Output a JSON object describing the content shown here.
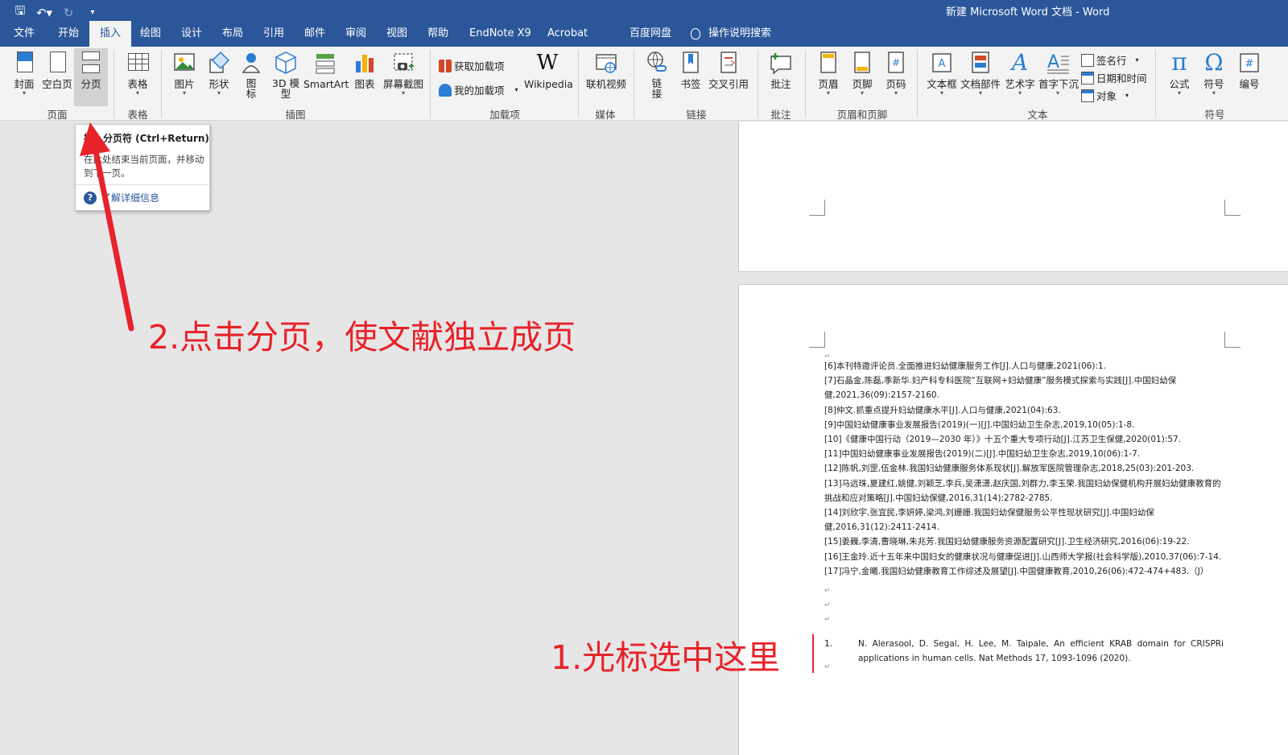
{
  "titlebar": {
    "title": "新建 Microsoft Word 文档  -  Word",
    "qat": [
      "save-icon",
      "undo-icon",
      "redo-icon",
      "customize-icon"
    ]
  },
  "tabs": [
    {
      "label": "文件"
    },
    {
      "label": "开始"
    },
    {
      "label": "插入",
      "active": true
    },
    {
      "label": "绘图"
    },
    {
      "label": "设计"
    },
    {
      "label": "布局"
    },
    {
      "label": "引用"
    },
    {
      "label": "邮件"
    },
    {
      "label": "审阅"
    },
    {
      "label": "视图"
    },
    {
      "label": "帮助"
    },
    {
      "label": "EndNote X9"
    },
    {
      "label": "Acrobat"
    },
    {
      "label": "百度网盘"
    },
    {
      "label": "操作说明搜索"
    }
  ],
  "ribbon": {
    "pages": {
      "cover": "封面",
      "blank": "空白页",
      "break": "分页",
      "group": "页面"
    },
    "tables": {
      "table": "表格",
      "group": "表格"
    },
    "illustrations": {
      "picture": "图片",
      "shapes": "形状",
      "icons": "图\n标",
      "model3d": "3D 模\n型",
      "smartart": "SmartArt",
      "chart": "图表",
      "screenshot": "屏幕截图",
      "group": "插图"
    },
    "addins": {
      "get": "获取加载项",
      "my": "我的加载项",
      "wikipedia": "Wikipedia",
      "group": "加载项"
    },
    "media": {
      "video": "联机视频",
      "group": "媒体"
    },
    "links": {
      "link": "链\n接",
      "bookmark": "书签",
      "crossref": "交叉引用",
      "group": "链接"
    },
    "comments": {
      "comment": "批注",
      "group": "批注"
    },
    "headerfooter": {
      "header": "页眉",
      "footer": "页脚",
      "pagenum": "页码",
      "group": "页眉和页脚"
    },
    "text": {
      "textbox": "文本框",
      "parts": "文档部件",
      "wordart": "艺术字",
      "dropcap": "首字下沉",
      "signature": "签名行",
      "datetime": "日期和时间",
      "object": "对象",
      "group": "文本"
    },
    "symbols": {
      "equation": "公式",
      "symbol": "符号",
      "number": "编号",
      "group": "符号"
    }
  },
  "tooltip": {
    "title": "插入分页符 (Ctrl+Return)",
    "desc": "在此处结束当前页面，并移动到下一页。",
    "help": "了解详细信息"
  },
  "document": {
    "refs": [
      "[6]本刊特邀评论员.全面推进妇幼健康服务工作[J].人口与健康,2021(06):1.",
      "[7]石晶金,陈磊,季新华.妇产科专科医院“互联网+妇幼健康”服务模式探索与实践[J].中国妇幼保",
      "健,2021,36(09):2157-2160.",
      "[8]仲文.抓重点提升妇幼健康水平[J].人口与健康,2021(04):63.",
      "[9]中国妇幼健康事业发展报告(2019)(一)[J].中国妇幼卫生杂志,2019,10(05):1-8.",
      "[10]《健康中国行动（2019—2030 年）》十五个重大专项行动[J].江苏卫生保健,2020(01):57.",
      "[11]中国妇幼健康事业发展报告(2019)(二)[J].中国妇幼卫生杂志,2019,10(06):1-7.",
      "[12]陈帆,刘罡,伍金林.我国妇幼健康服务体系现状[J].解放军医院管理杂志,2018,25(03):201-203.",
      "[13]马远珠,夏建红,姚健,刘颖芝,李兵,吴潇潇,赵庆国,刘群力,李玉荣.我国妇幼保健机构开展妇幼健康教育的",
      "挑战和应对策略[J].中国妇幼保健,2016,31(14):2782-2785.",
      "[14]刘欣宇,张宜民,李妍婷,梁鸿,刘姗姗.我国妇幼保健服务公平性现状研究[J].中国妇幼保",
      "健,2016,31(12):2411-2414.",
      "[15]姜巍,李清,曹晓琳,朱兆芳.我国妇幼健康服务资源配置研究[J].卫生经济研究,2016(06):19-22.",
      "[16]王金玲.近十五年来中国妇女的健康状况与健康促进[J].山西师大学报(社会科学版),2010,37(06):7-14.",
      "[17]冯宁,金曦.我国妇幼健康教育工作综述及展望[J].中国健康教育,2010,26(06):472-474+483.（J）"
    ],
    "end_ref_num": "1.",
    "end_ref_text": "N. Alerasool, D. Segal, H. Lee, M. Taipale, An efficient KRAB domain for CRISPRi applications in human cells. Nat Methods 17, 1093-1096 (2020)."
  },
  "annotations": {
    "step2": "2.点击分页，使文献独立成页",
    "step1": "1.光标选中这里",
    "color": "#e8222a"
  }
}
